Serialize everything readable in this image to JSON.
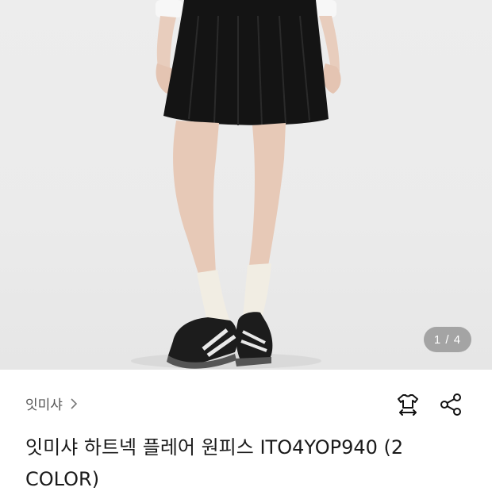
{
  "gallery": {
    "counter": "1 / 4"
  },
  "product": {
    "brand": "잇미샤",
    "title": "잇미샤 하트넥 플레어 원피스 ITO4YOP940 (2 COLOR)"
  },
  "icons": {
    "brand_chevron": "chevron-right-icon",
    "size_guide": "shirt-size-icon",
    "share": "share-icon"
  }
}
